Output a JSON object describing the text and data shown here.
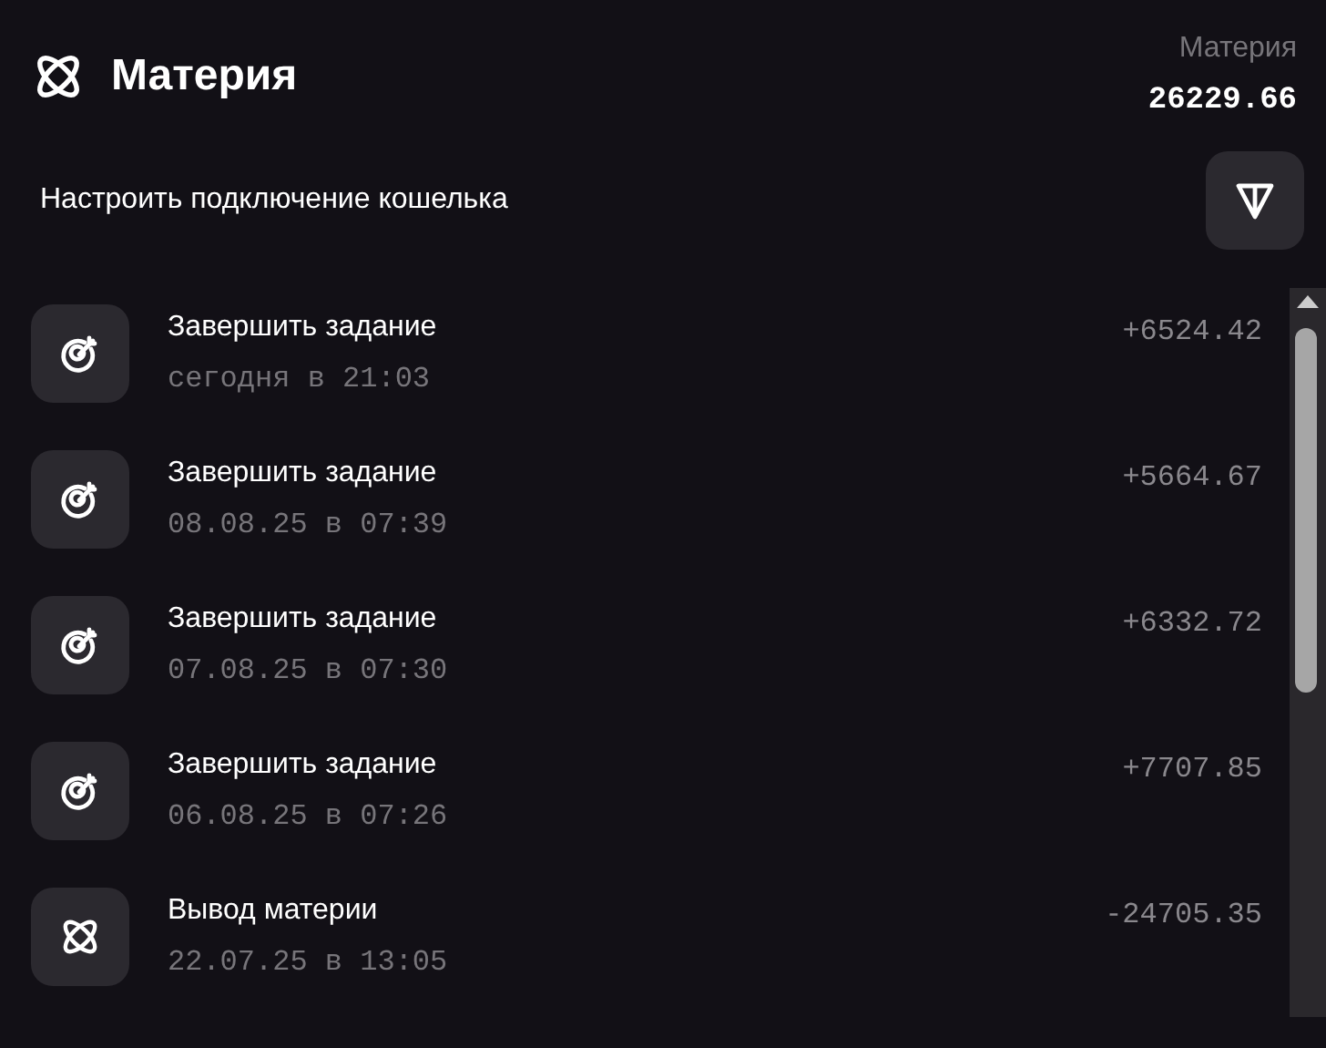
{
  "header": {
    "title": "Материя",
    "balance_label": "Материя",
    "balance": "26229.66"
  },
  "wallet": {
    "label": "Настроить подключение кошелька"
  },
  "transactions": [
    {
      "kind": "task",
      "title": "Завершить задание",
      "time": "сегодня в 21:03",
      "amount": "+6524.42"
    },
    {
      "kind": "task",
      "title": "Завершить задание",
      "time": "08.08.25 в 07:39",
      "amount": "+5664.67"
    },
    {
      "kind": "task",
      "title": "Завершить задание",
      "time": "07.08.25 в 07:30",
      "amount": "+6332.72"
    },
    {
      "kind": "task",
      "title": "Завершить задание",
      "time": "06.08.25 в 07:26",
      "amount": "+7707.85"
    },
    {
      "kind": "withdraw",
      "title": "Вывод материи",
      "time": "22.07.25 в 13:05",
      "amount": "-24705.35"
    }
  ]
}
